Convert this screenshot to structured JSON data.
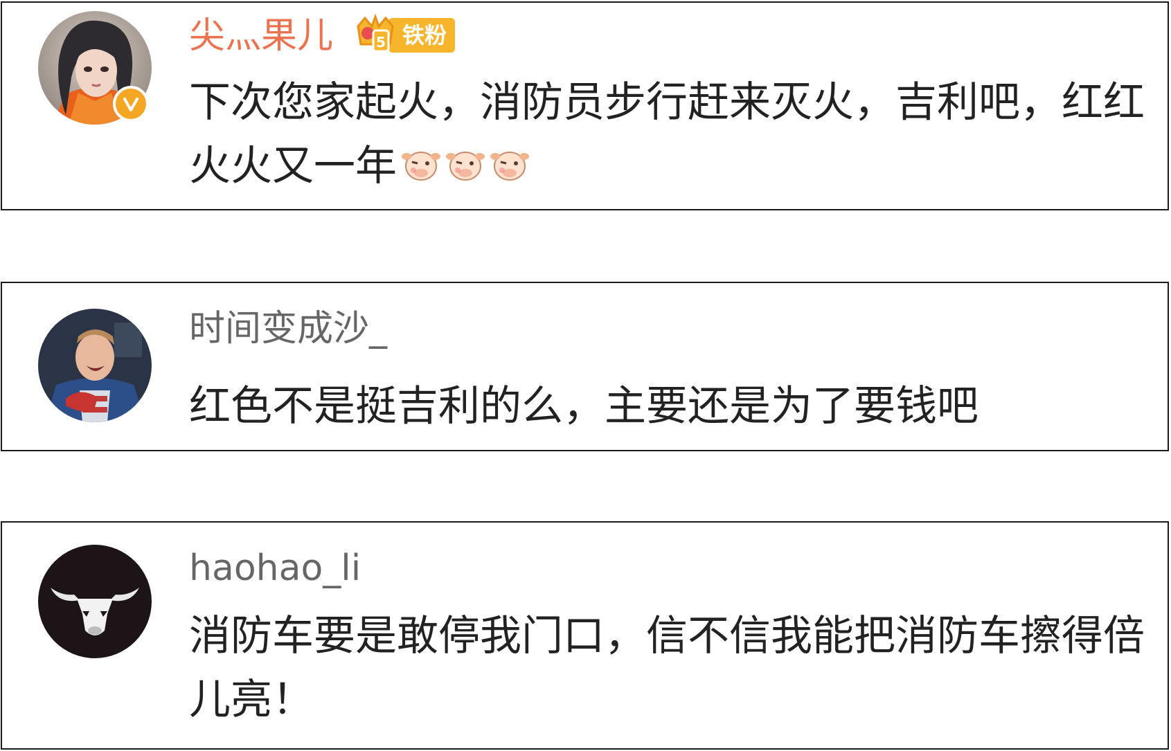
{
  "comments": [
    {
      "username": "尖灬果儿",
      "fan_badge": "铁粉",
      "text": "下次您家起火，消防员步行赶来灭火，吉利吧，红红火火又一年",
      "emojis": [
        "cow-wink-emoji",
        "cow-wink-emoji",
        "cow-wink-emoji"
      ],
      "avatar": "anime-girl-avatar",
      "verified_icon": "vip-v-icon",
      "colors": {
        "username": "#eb7350",
        "badge": "#f7b52c",
        "verified": "#f5a623"
      }
    },
    {
      "username": "时间变成沙_",
      "text": "红色不是挺吉利的么，主要还是为了要钱吧",
      "avatar": "captain-hero-avatar",
      "colors": {
        "username": "#666666"
      }
    },
    {
      "username": "haohao_li",
      "text": "消防车要是敢停我门口，信不信我能把消防车擦得倍儿亮！",
      "avatar": "bull-logo-avatar",
      "colors": {
        "username": "#666666"
      }
    }
  ]
}
